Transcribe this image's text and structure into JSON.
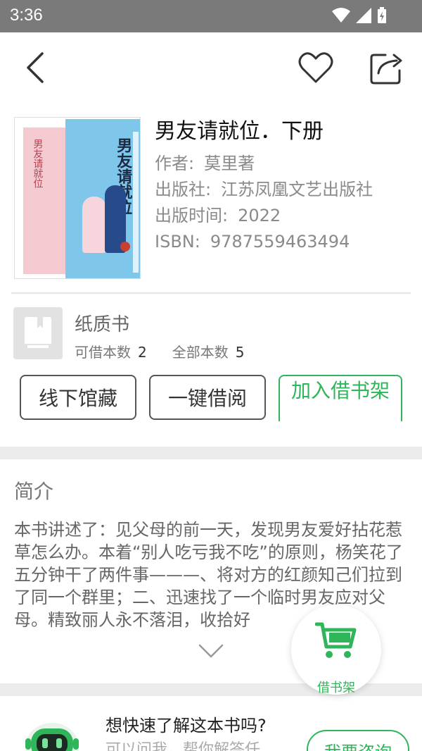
{
  "status_bar": {
    "time": "3:36"
  },
  "book": {
    "title": "男友请就位．下册",
    "author_label": "作者:",
    "author": "莫里著",
    "publisher_label": "出版社:",
    "publisher": "江苏凤凰文艺出版社",
    "pub_time_label": "出版时间:",
    "pub_time": "2022",
    "isbn_label": "ISBN:",
    "isbn": "9787559463494",
    "cover_title": "男友请就位"
  },
  "paper": {
    "label": "纸质书",
    "available_label": "可借本数",
    "available": "2",
    "total_label": "全部本数",
    "total": "5"
  },
  "actions": {
    "offline": "线下馆藏",
    "borrow": "一键借阅",
    "add_shelf": "加入借书架"
  },
  "intro": {
    "title": "简介",
    "text": "本书讲述了：见父母的前一天，发现男友爱好拈花惹草怎么办。本着“别人吃亏我不吃”的原则，杨笑花了五分钟干了两件事———、将对方的红颜知己们拉到了同一个群里；二、迅速找了一个临时男友应对父母。精致丽人永不落泪，收拾好"
  },
  "fab": {
    "label": "借书架"
  },
  "ask": {
    "title": "想快速了解这本书吗?",
    "subtitle": "可以问我，帮你解答任",
    "button": "我要咨询"
  },
  "colors": {
    "accent": "#2fb55a",
    "status_bar": "#7a7a7a"
  }
}
